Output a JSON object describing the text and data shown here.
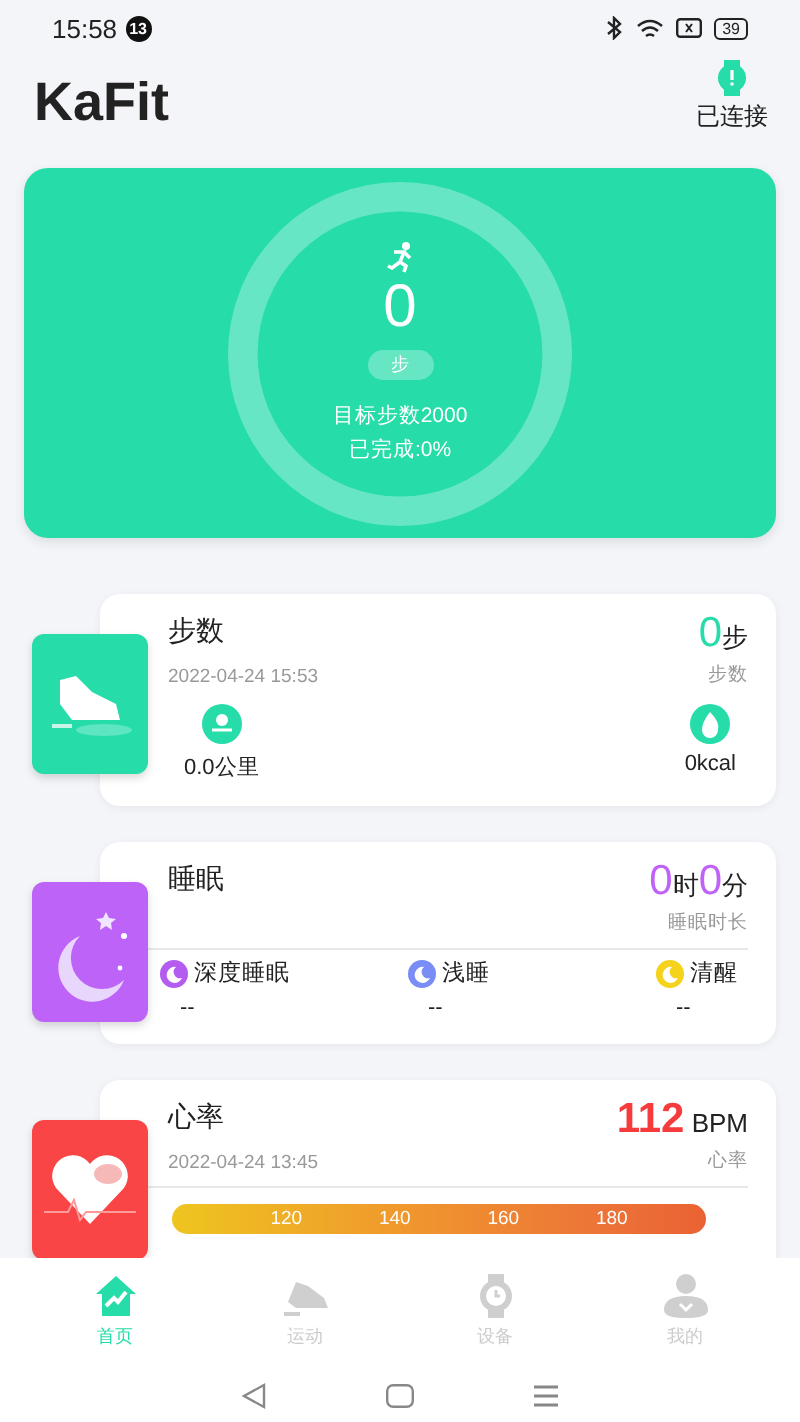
{
  "status_bar": {
    "time": "15:58",
    "notification_count": "13",
    "battery": "39"
  },
  "header": {
    "title": "KaFit",
    "device_status": "已连接"
  },
  "summary": {
    "value": "0",
    "unit": "步",
    "goal": "目标步数2000",
    "completed": "已完成:0%"
  },
  "cards": [
    {
      "kind": "steps",
      "title": "步数",
      "time": "2022-04-24 15:53",
      "value": "0",
      "unit": "步",
      "caption": "步数",
      "stats": [
        {
          "kind": "distance",
          "value": "0.0公里"
        },
        {
          "kind": "calories",
          "value": "0kcal"
        }
      ]
    },
    {
      "kind": "sleep",
      "title": "睡眠",
      "hours": "0",
      "hours_unit": "时",
      "minutes": "0",
      "minutes_unit": "分",
      "caption": "睡眠时长",
      "stages": [
        {
          "label": "深度睡眠",
          "value": "--",
          "color": "#b45cf0"
        },
        {
          "label": "浅睡",
          "value": "--",
          "color": "#7a8cf5"
        },
        {
          "label": "清醒",
          "value": "--",
          "color": "#f5d21c"
        }
      ]
    },
    {
      "kind": "heart",
      "title": "心率",
      "time": "2022-04-24 13:45",
      "value": "112",
      "unit": "BPM",
      "caption": "心率",
      "zone_ticks": [
        "120",
        "140",
        "160",
        "180"
      ]
    }
  ],
  "tabs": [
    {
      "label": "首页",
      "kind": "home",
      "selected": true
    },
    {
      "label": "运动",
      "kind": "sport",
      "selected": false
    },
    {
      "label": "设备",
      "kind": "device",
      "selected": false
    },
    {
      "label": "我的",
      "kind": "profile",
      "selected": false
    }
  ]
}
